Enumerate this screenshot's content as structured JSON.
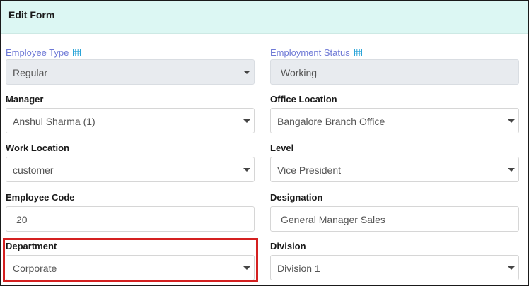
{
  "header": {
    "title": "Edit Form"
  },
  "left": {
    "employee_type": {
      "label": "Employee Type",
      "value": "Regular",
      "icon": "grid-icon"
    },
    "manager": {
      "label": "Manager",
      "value": "Anshul Sharma (1)"
    },
    "work_location": {
      "label": "Work Location",
      "value": "customer"
    },
    "employee_code": {
      "label": "Employee Code",
      "value": "20"
    },
    "department": {
      "label": "Department",
      "value": "Corporate"
    }
  },
  "right": {
    "employment_status": {
      "label": "Employment Status",
      "value": "Working",
      "icon": "grid-icon"
    },
    "office_location": {
      "label": "Office Location",
      "value": "Bangalore Branch Office"
    },
    "level": {
      "label": "Level",
      "value": "Vice President"
    },
    "designation": {
      "label": "Designation",
      "value": "General Manager Sales"
    },
    "division": {
      "label": "Division",
      "value": "Division 1"
    }
  },
  "colors": {
    "header_bg": "#dcf7f3",
    "link_label": "#6e79d6",
    "icon": "#2aa4d8",
    "highlight": "#d42020"
  }
}
